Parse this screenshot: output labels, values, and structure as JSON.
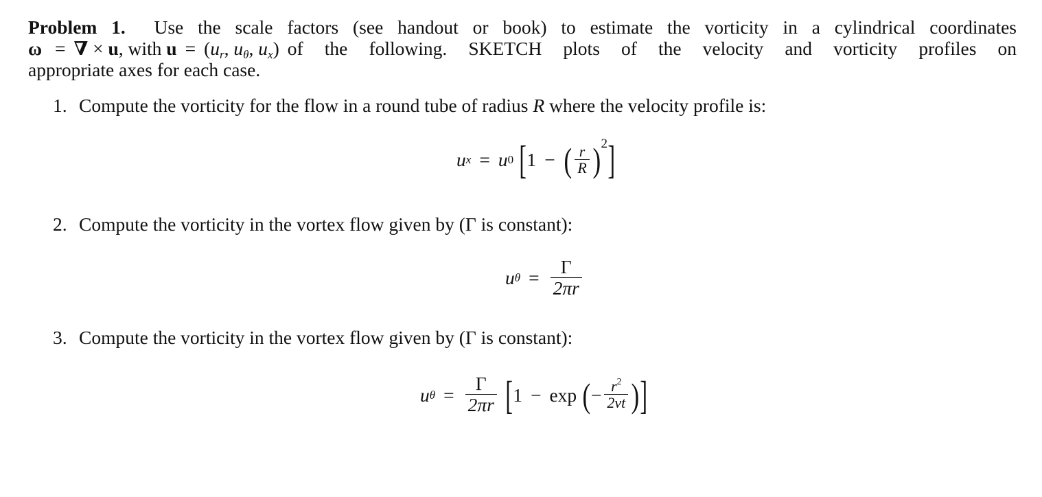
{
  "problem": {
    "heading": "Problem 1.",
    "intro_line1": "Use the scale factors (see handout or book) to estimate the vorticity in a cylindrical coordinates",
    "intro_line2_math": {
      "omega": "ω",
      "eq": "=",
      "nabla": "∇",
      "times": "×",
      "u": "u",
      "with_text": ", with",
      "u2": "u",
      "eq2": "=",
      "tuple_open": "(",
      "ur": "u",
      "ur_sub": "r",
      "comma1": ", ",
      "utheta": "u",
      "utheta_sub": "θ",
      "comma2": ", ",
      "ux": "u",
      "ux_sub": "x",
      "tuple_close": ")"
    },
    "intro_line2_text": "of the following.  SKETCH plots of the velocity and vorticity profiles on",
    "intro_line3": "appropriate axes for each case."
  },
  "items": [
    {
      "number": "1.",
      "text_before": "Compute the vorticity for the flow in a round tube of radius ",
      "var": "R",
      "text_after": " where the velocity profile is:",
      "equation": {
        "lhs": "u",
        "lhs_sub": "x",
        "eq": "=",
        "coef": "u",
        "coef_sub": "0",
        "lbracket": "[",
        "one": "1",
        "minus": "−",
        "lparen": "(",
        "frac_num": "r",
        "frac_den": "R",
        "rparen": ")",
        "exponent": "2",
        "rbracket": "]"
      }
    },
    {
      "number": "2.",
      "text": "Compute the vorticity in the vortex flow given by (Γ is constant):",
      "equation": {
        "lhs": "u",
        "lhs_sub": "θ",
        "eq": "=",
        "frac_num": "Γ",
        "frac_den": "2πr"
      }
    },
    {
      "number": "3.",
      "text": "Compute the vorticity in the vortex flow given by (Γ is constant):",
      "equation": {
        "lhs": "u",
        "lhs_sub": "θ",
        "eq": "=",
        "frac_num": "Γ",
        "frac_den": "2πr",
        "lbracket": "[",
        "one": "1",
        "minus": "−",
        "func": "exp",
        "lparen": "(",
        "neg": "−",
        "inner_num": "r",
        "inner_num_sup": "2",
        "inner_den": "2νt",
        "rparen": ")",
        "rbracket": "]"
      }
    }
  ]
}
